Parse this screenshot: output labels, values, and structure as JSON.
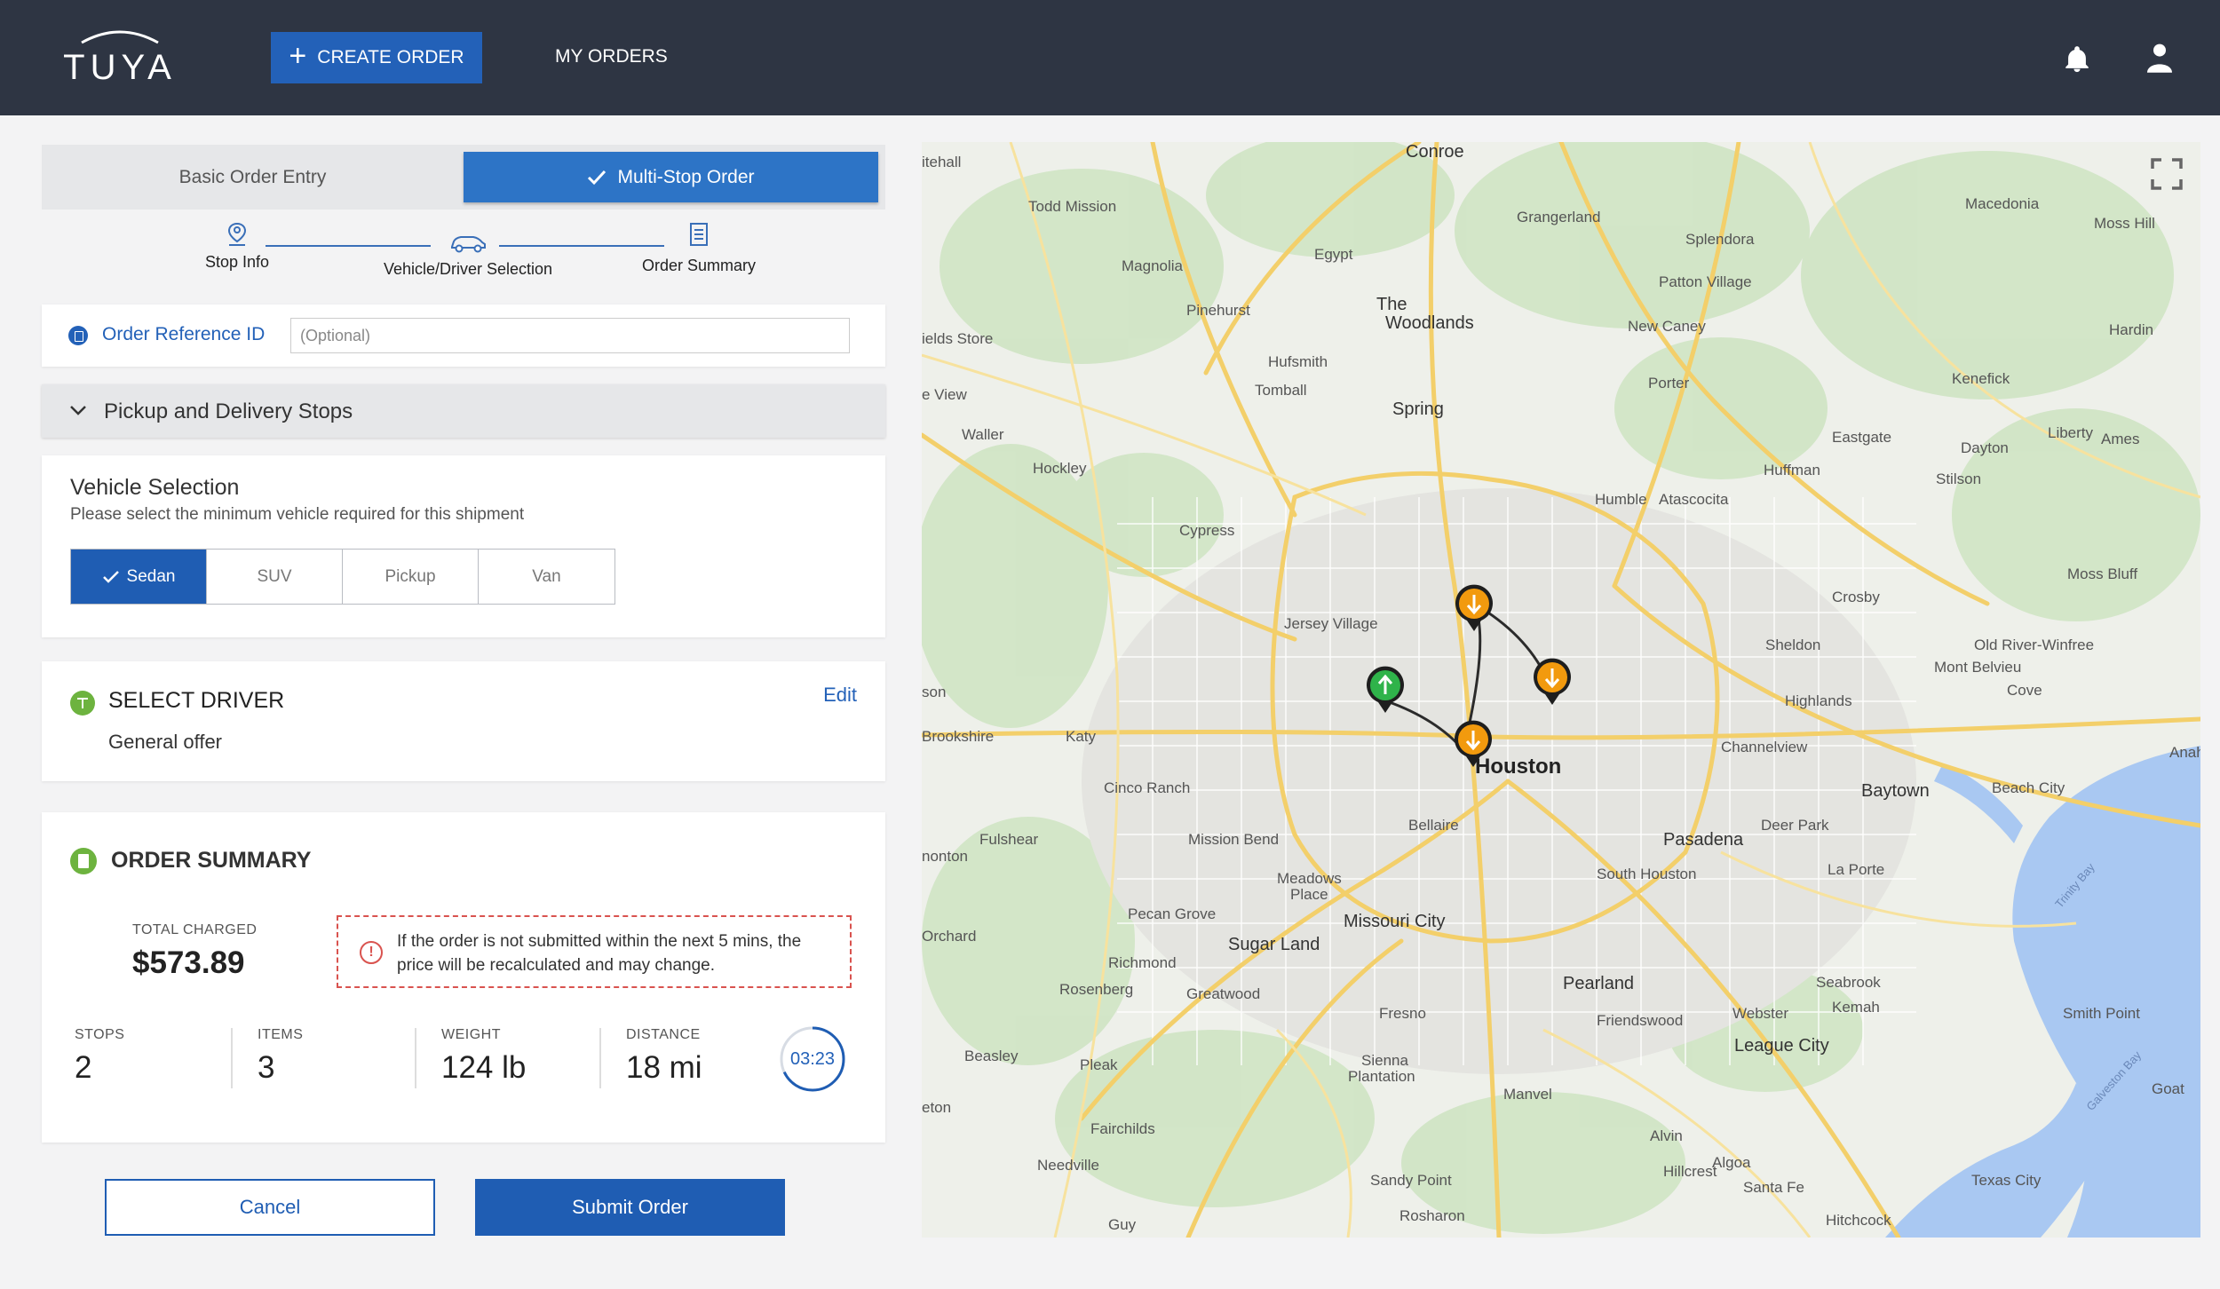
{
  "header": {
    "logo_text": "TUYA",
    "create_order_label": "CREATE ORDER",
    "my_orders_label": "MY ORDERS"
  },
  "mode_tabs": {
    "basic_label": "Basic Order Entry",
    "multi_label": "Multi-Stop Order"
  },
  "stepper": {
    "steps": [
      {
        "label": "Stop Info",
        "icon": "person-pin-icon"
      },
      {
        "label": "Vehicle/Driver Selection",
        "icon": "car-icon"
      },
      {
        "label": "Order Summary",
        "icon": "document-icon"
      }
    ]
  },
  "order_reference": {
    "label": "Order Reference ID",
    "placeholder": "(Optional)",
    "value": ""
  },
  "stops_section": {
    "title": "Pickup and Delivery Stops"
  },
  "vehicle_selection": {
    "title": "Vehicle Selection",
    "subtitle": "Please select the minimum vehicle required for this shipment",
    "options": [
      "Sedan",
      "SUV",
      "Pickup",
      "Van"
    ],
    "selected": "Sedan"
  },
  "driver": {
    "title": "SELECT DRIVER",
    "value": "General offer",
    "edit_label": "Edit"
  },
  "summary": {
    "title": "ORDER SUMMARY",
    "total_label": "TOTAL CHARGED",
    "total_value": "$573.89",
    "warning": "If the order is not submitted within the next 5 mins, the price will be recalculated and may change.",
    "stats": [
      {
        "label": "STOPS",
        "value": "2"
      },
      {
        "label": "ITEMS",
        "value": "3"
      },
      {
        "label": "WEIGHT",
        "value": "124 lb"
      },
      {
        "label": "DISTANCE",
        "value": "18 mi"
      }
    ],
    "timer": "03:23",
    "timer_fraction": 0.68
  },
  "actions": {
    "cancel_label": "Cancel",
    "submit_label": "Submit Order"
  },
  "colors": {
    "header_bg": "#2e3543",
    "primary": "#1f5db3",
    "accent_green": "#6db33f",
    "warning_red": "#d9534f",
    "pin_orange": "#f29a0e",
    "pin_green": "#2fb34a"
  },
  "map": {
    "labels": {
      "conroe": "Conroe",
      "todd_mission": "Todd Mission",
      "grangerland": "Grangerland",
      "macedonia": "Macedonia",
      "moss_hill": "Moss Hill",
      "magnolia": "Magnolia",
      "egypt": "Egypt",
      "splendora": "Splendora",
      "patton_village": "Patton Village",
      "the": "The",
      "woodlands": "Woodlands",
      "pinehurst": "Pinehurst",
      "hitchall": "itehall",
      "fields_store": "ields Store",
      "hufsmith": "Hufsmith",
      "new_caney": "New Caney",
      "hardin": "Hardin",
      "tomball": "Tomball",
      "porter": "Porter",
      "kenefick": "Kenefick",
      "view": "e View",
      "spring": "Spring",
      "waller": "Waller",
      "eastgate": "Eastgate",
      "liberty": "Liberty",
      "ames": "Ames",
      "dayton": "Dayton",
      "hockley": "Hockley",
      "huffman": "Huffman",
      "stilson": "Stilson",
      "humble": "Humble",
      "atascocita": "Atascocita",
      "cypress": "Cypress",
      "moss_bluff": "Moss Bluff",
      "crosby": "Crosby",
      "jersey_village": "Jersey Village",
      "sheldon": "Sheldon",
      "old_river": "Old River-Winfree",
      "mont_belvieu": "Mont Belvieu",
      "son": "son",
      "highlands": "Highlands",
      "cove": "Cove",
      "brookshire": "Brookshire",
      "katy": "Katy",
      "channelview": "Channelview",
      "anahuac": "Anahu",
      "houston": "Houston",
      "baytown": "Baytown",
      "cinco_ranch": "Cinco Ranch",
      "beach_city": "Beach City",
      "bellaire": "Bellaire",
      "deer_park": "Deer Park",
      "fulshear": "Fulshear",
      "mission_bend": "Mission Bend",
      "pasadena": "Pasadena",
      "nonton": "nonton",
      "south_houston": "South Houston",
      "la_porte": "La Porte",
      "meadows": "Meadows",
      "place": "Place",
      "trinity_bay": "Trinity Bay",
      "pecan_grove": "Pecan Grove",
      "missouri_city": "Missouri City",
      "orchard": "Orchard",
      "sugar_land": "Sugar Land",
      "richmond": "Richmond",
      "pearland": "Pearland",
      "seabrook": "Seabrook",
      "rosenberg": "Rosenberg",
      "greatwood": "Greatwood",
      "kemah": "Kemah",
      "fresno": "Fresno",
      "friendswood": "Friendswood",
      "webster": "Webster",
      "smith_point": "Smith Point",
      "beasley": "Beasley",
      "pleak": "Pleak",
      "sienna": "Sienna",
      "plantation": "Plantation",
      "league_city": "League City",
      "galveston_bay": "Galveston Bay",
      "goat": "Goat",
      "eton": "eton",
      "manvel": "Manvel",
      "fairchilds": "Fairchilds",
      "alvin": "Alvin",
      "needville": "Needville",
      "hillcrest": "Hillcrest",
      "algoa": "Algoa",
      "texas_city": "Texas City",
      "sandy_point": "Sandy Point",
      "santa_fe": "Santa Fe",
      "guy": "Guy",
      "rosharon": "Rosharon",
      "hitchcock": "Hitchcock"
    }
  }
}
